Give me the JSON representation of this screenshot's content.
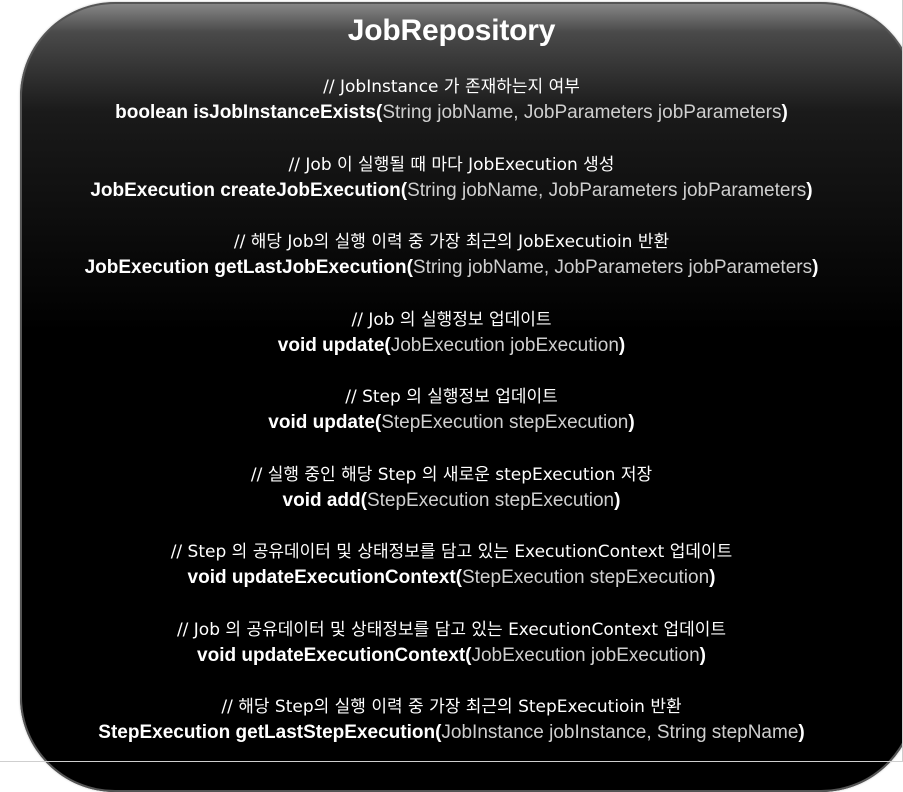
{
  "title": "JobRepository",
  "methods": [
    {
      "comment": "// JobInstance 가 존재하는지 여부",
      "head": "boolean isJobInstanceExists(",
      "params": "String jobName, JobParameters jobParameters",
      "tail": ")"
    },
    {
      "comment": "// Job 이 실행될 때 마다 JobExecution 생성",
      "head": "JobExecution createJobExecution(",
      "params": "String jobName, JobParameters jobParameters",
      "tail": ")"
    },
    {
      "comment": "// 해당 Job의 실행 이력 중 가장 최근의 JobExecutioin 반환",
      "head": "JobExecution getLastJobExecution(",
      "params": "String jobName, JobParameters jobParameters",
      "tail": ")"
    },
    {
      "comment": "// Job 의 실행정보 업데이트",
      "head": "void update(",
      "params": "JobExecution jobExecution",
      "tail": ")"
    },
    {
      "comment": "// Step 의 실행정보 업데이트",
      "head": "void update(",
      "params": "StepExecution stepExecution",
      "tail": ")"
    },
    {
      "comment": "// 실행 중인 해당 Step 의 새로운 stepExecution 저장",
      "head": "void add(",
      "params": "StepExecution stepExecution",
      "tail": ")"
    },
    {
      "comment": "// Step 의 공유데이터 및 상태정보를 담고 있는 ExecutionContext 업데이트",
      "head": "void updateExecutionContext(",
      "params": "StepExecution stepExecution",
      "tail": ")"
    },
    {
      "comment": "// Job 의 공유데이터 및 상태정보를 담고 있는 ExecutionContext 업데이트",
      "head": "void updateExecutionContext(",
      "params": "JobExecution jobExecution",
      "tail": ")"
    },
    {
      "comment": "// 해당 Step의 실행 이력 중 가장 최근의 StepExecutioin 반환",
      "head": "StepExecution getLastStepExecution(",
      "params": "JobInstance jobInstance, String stepName",
      "tail": ")"
    }
  ]
}
